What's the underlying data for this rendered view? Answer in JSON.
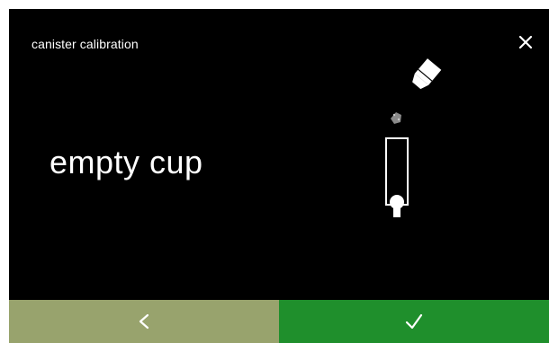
{
  "header": {
    "title": "canister calibration",
    "close_icon": "close-icon"
  },
  "main": {
    "instruction": "empty cup",
    "illustration_icons": [
      "canister-icon",
      "powder-icon",
      "cup-icon"
    ]
  },
  "footer": {
    "back_icon": "chevron-left-icon",
    "confirm_icon": "checkmark-icon",
    "back_color": "#98a36d",
    "confirm_color": "#1f8f2c"
  },
  "colors": {
    "background": "#000000",
    "text": "#ffffff"
  }
}
